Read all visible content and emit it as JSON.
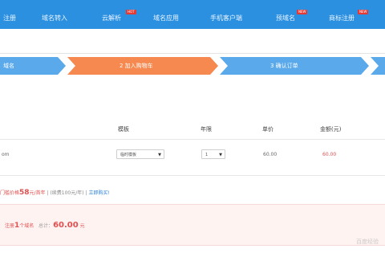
{
  "topnav": {
    "bg_color": "#2b90e0",
    "items": [
      {
        "label": "注册"
      },
      {
        "label": "域名转入"
      },
      {
        "label": "云解析",
        "badge": "HOT"
      },
      {
        "label": "域名应用"
      },
      {
        "label": "手机客户端"
      },
      {
        "label": "预域名",
        "badge": "NEW"
      },
      {
        "label": "商标注册",
        "badge": "NEW"
      }
    ]
  },
  "steps": {
    "active_color": "#f5894f",
    "inactive_color": "#5aa9ea",
    "items": [
      {
        "label": "域名"
      },
      {
        "label": "2 加入购物车"
      },
      {
        "label": "3 确认订单"
      }
    ]
  },
  "table": {
    "headers": {
      "template": "模板",
      "years": "年限",
      "unit_price": "单价",
      "amount": "金额(元)"
    },
    "row": {
      "domain_suffix": "om",
      "template_select": "临时模板",
      "years_select": "1",
      "unit_price": "60.00",
      "amount": "60.00"
    }
  },
  "promo": {
    "prefix": "门槛价格",
    "price": "58",
    "unit": "元/首年",
    "middle": "(续费100元/年)",
    "link": "立即购买!"
  },
  "summary": {
    "prefix": "注册",
    "count": "1",
    "count_suffix": "个域名",
    "total_label": "总计：",
    "total": "60.00",
    "currency": "元"
  },
  "watermark": "百度经验"
}
